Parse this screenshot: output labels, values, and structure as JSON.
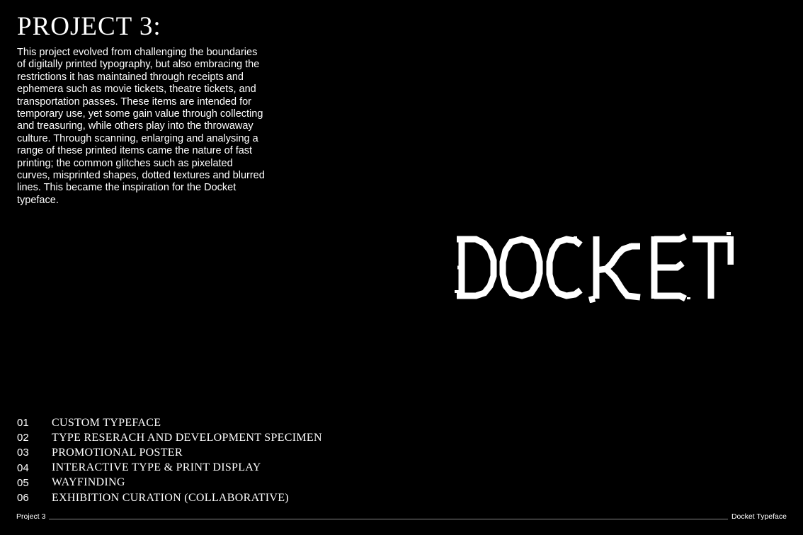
{
  "header": {
    "title": "PROJECT 3:"
  },
  "description": "This project evolved from challenging the boundaries of digitally printed typography, but also embracing the restrictions it has maintained through receipts and ephemera such as movie tickets, theatre tickets, and transportation passes. These items are intended for temporary use, yet some gain value through collecting and treasuring, while others play into the throwaway culture. Through scanning, enlarging and analysing a range of these printed items came the nature of fast printing; the common glitches such as pixelated curves, misprinted shapes, dotted textures and blurred lines. This became the inspiration for the Docket typeface.",
  "wordmark": {
    "text": "DOCKET",
    "color": "#ffffff"
  },
  "deliverables": [
    {
      "number": "01",
      "label": "Custom Typeface"
    },
    {
      "number": "02",
      "label": "Type Reserach and Development Specimen"
    },
    {
      "number": "03",
      "label": "Promotional Poster"
    },
    {
      "number": "04",
      "label": "Interactive Type & Print Display"
    },
    {
      "number": "05",
      "label": "Wayfinding"
    },
    {
      "number": "06",
      "label": "Exhibition Curation (Collaborative)"
    }
  ],
  "footer": {
    "left": "Project 3",
    "right": "Docket Typeface"
  },
  "colors": {
    "background": "#000000",
    "text": "#ffffff",
    "rule": "#8a8a8a"
  }
}
